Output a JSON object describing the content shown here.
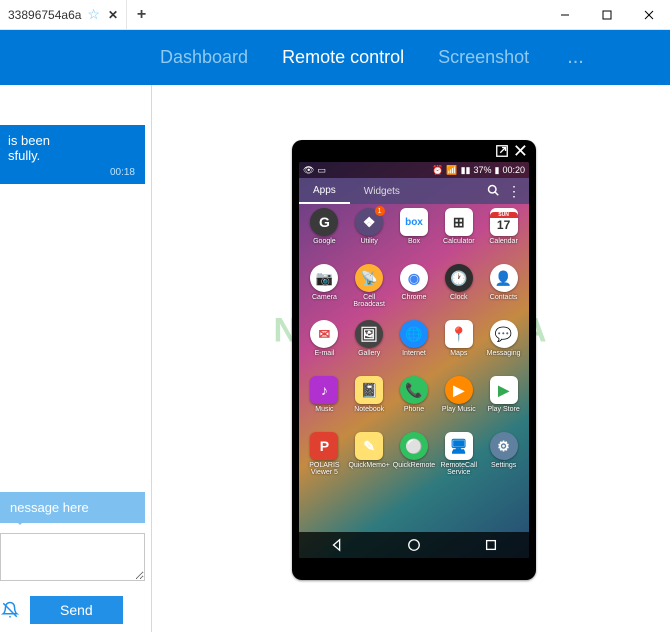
{
  "browser": {
    "tab_title": "33896754a6a",
    "newtab": "+"
  },
  "header": {
    "items": [
      "Dashboard",
      "Remote control",
      "Screenshot"
    ],
    "active": 1,
    "more": "..."
  },
  "chat": {
    "bubble_line1": "is been",
    "bubble_line2": "sfully.",
    "bubble_time": "00:18",
    "hint": "nessage here",
    "send": "Send"
  },
  "watermark": "NESABAMEDIA",
  "phone": {
    "status": {
      "battery_pct": "37%",
      "time": "00:20"
    },
    "tabs": {
      "apps": "Apps",
      "widgets": "Widgets"
    },
    "apps": [
      {
        "label": "Google",
        "bg": "#3a3a3a",
        "glyph": "G",
        "shape": "circle"
      },
      {
        "label": "Utility",
        "bg": "#5a4a7a",
        "glyph": "❖",
        "shape": "circle",
        "badge": "1"
      },
      {
        "label": "Box",
        "bg": "#ffffff",
        "glyph": "box",
        "fg": "#1a8cff"
      },
      {
        "label": "Calculator",
        "bg": "#ffffff",
        "glyph": "⊞",
        "fg": "#333"
      },
      {
        "label": "Calendar",
        "bg": "#ffffff",
        "glyph": "17",
        "fg": "#d33",
        "sub": "SUN"
      },
      {
        "label": "Camera",
        "bg": "#ffffff",
        "glyph": "📷",
        "shape": "circle"
      },
      {
        "label": "Cell Broadcast",
        "bg": "#ffb030",
        "glyph": "📡",
        "shape": "circle"
      },
      {
        "label": "Chrome",
        "bg": "#ffffff",
        "glyph": "◉",
        "shape": "circle",
        "fg": "#4285f4"
      },
      {
        "label": "Clock",
        "bg": "#2e2e2e",
        "glyph": "🕐",
        "shape": "circle"
      },
      {
        "label": "Contacts",
        "bg": "#ffffff",
        "glyph": "👤",
        "shape": "circle"
      },
      {
        "label": "E-mail",
        "bg": "#ffffff",
        "glyph": "✉",
        "shape": "circle",
        "fg": "#d44"
      },
      {
        "label": "Gallery",
        "bg": "#444",
        "glyph": "🖼",
        "shape": "circle"
      },
      {
        "label": "Internet",
        "bg": "#1a8cff",
        "glyph": "🌐",
        "shape": "circle"
      },
      {
        "label": "Maps",
        "bg": "#ffffff",
        "glyph": "📍",
        "fg": "#34a853"
      },
      {
        "label": "Messaging",
        "bg": "#ffffff",
        "glyph": "💬",
        "shape": "circle",
        "fg": "#ffa500"
      },
      {
        "label": "Music",
        "bg": "#b030d0",
        "glyph": "♪"
      },
      {
        "label": "Notebook",
        "bg": "#ffe070",
        "glyph": "📓"
      },
      {
        "label": "Phone",
        "bg": "#30c060",
        "glyph": "📞",
        "shape": "circle"
      },
      {
        "label": "Play Music",
        "bg": "#ff8a00",
        "glyph": "▶",
        "shape": "circle"
      },
      {
        "label": "Play Store",
        "bg": "#ffffff",
        "glyph": "▶",
        "fg": "#34a853"
      },
      {
        "label": "POLARIS Viewer 5",
        "bg": "#e04030",
        "glyph": "P"
      },
      {
        "label": "QuickMemo+",
        "bg": "#ffe070",
        "glyph": "✎"
      },
      {
        "label": "QuickRemote",
        "bg": "#30c060",
        "glyph": "⚪",
        "shape": "circle"
      },
      {
        "label": "RemoteCall Service",
        "bg": "#ffffff",
        "glyph": "🖥",
        "fg": "#0078d7"
      },
      {
        "label": "Settings",
        "bg": "#6080a0",
        "glyph": "⚙",
        "shape": "circle"
      }
    ]
  }
}
